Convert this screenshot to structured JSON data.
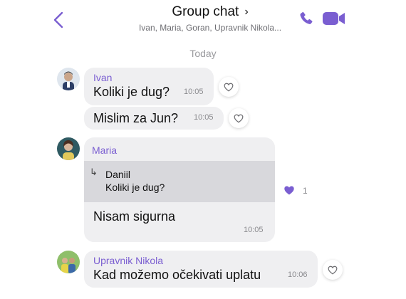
{
  "header": {
    "title": "Group chat",
    "chevron": "›",
    "subtitle": "Ivan, Maria, Goran, Upravnik Nikola...",
    "icons": [
      "back-arrow-icon",
      "phone-icon",
      "video-call-icon"
    ],
    "accent_color": "#7a5ed1"
  },
  "day_separator": "Today",
  "messages": [
    {
      "sender": "Ivan",
      "text": "Koliki je dug?",
      "time": "10:05",
      "liked": false
    },
    {
      "sender": "",
      "text": "Mislim za Jun?",
      "time": "10:05",
      "liked": false
    },
    {
      "sender": "Maria",
      "reply_to": {
        "name": "Daniil",
        "text": "Koliki je dug?"
      },
      "text": "Nisam sigurna",
      "time": "10:05",
      "liked": true,
      "like_count": "1"
    },
    {
      "sender": "Upravnik Nikola",
      "text": "Kad možemo očekivati uplatu",
      "time": "10:06",
      "liked": false
    }
  ],
  "reply_arrow": "↳"
}
